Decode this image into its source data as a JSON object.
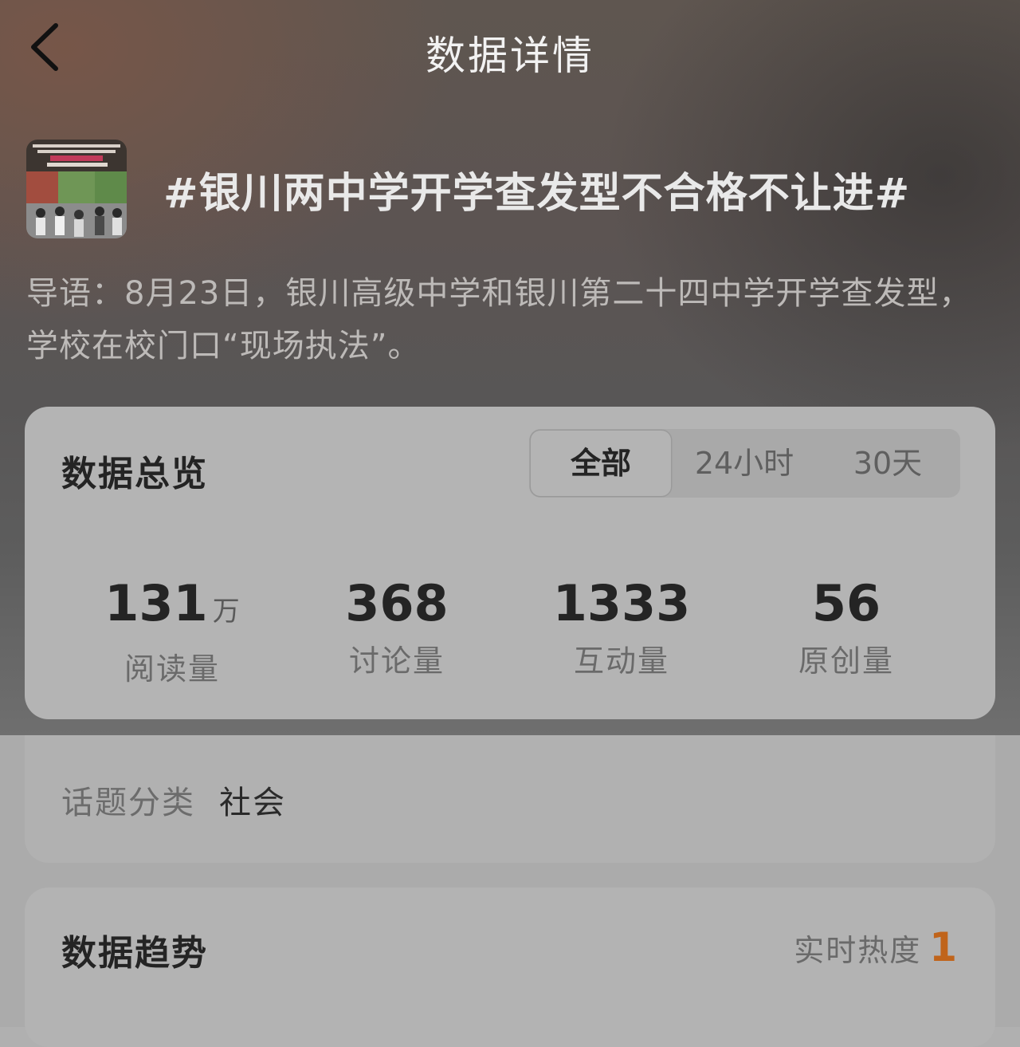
{
  "header": {
    "title": "数据详情"
  },
  "topic": {
    "title": "#银川两中学开学查发型不合格不让进#",
    "intro": "导语：8月23日，银川高级中学和银川第二十四中学开学查发型，学校在校门口“现场执法”。"
  },
  "overview": {
    "title": "数据总览",
    "tabs": [
      "全部",
      "24小时",
      "30天"
    ],
    "active_tab": "全部",
    "stats": [
      {
        "value": "131",
        "unit": "万",
        "label": "阅读量"
      },
      {
        "value": "368",
        "unit": "",
        "label": "讨论量"
      },
      {
        "value": "1333",
        "unit": "",
        "label": "互动量"
      },
      {
        "value": "56",
        "unit": "",
        "label": "原创量"
      }
    ]
  },
  "category": {
    "label": "话题分类",
    "value": "社会"
  },
  "trend": {
    "title": "数据趋势",
    "heat_label": "实时热度",
    "heat_value": "1",
    "heat_color": "#c0641b"
  }
}
